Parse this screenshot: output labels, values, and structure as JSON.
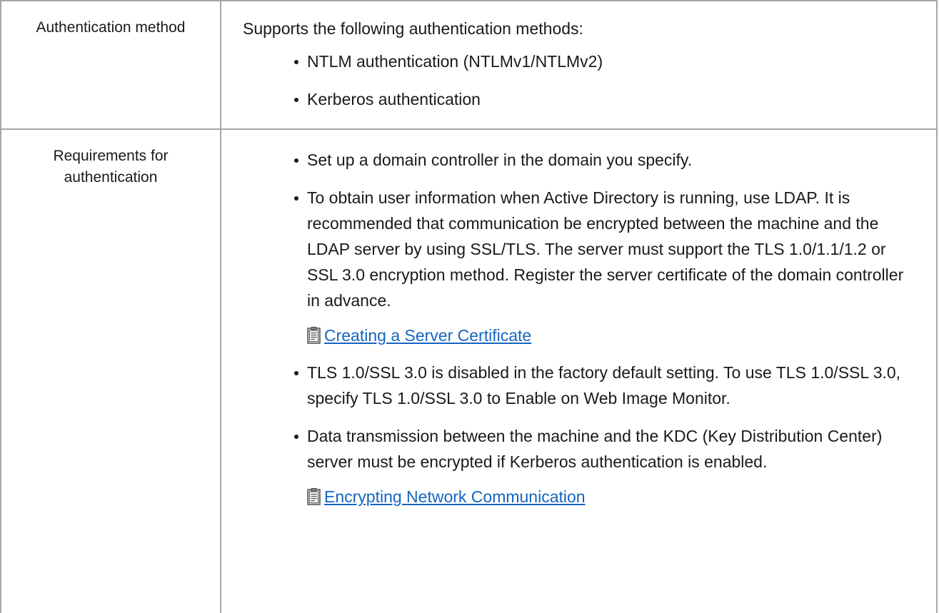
{
  "rows": [
    {
      "label": "Authentication method",
      "intro": "Supports the following authentication methods:",
      "items": [
        "NTLM authentication (NTLMv1/NTLMv2)",
        "Kerberos authentication"
      ]
    },
    {
      "label": "Requirements for authentication",
      "items": [
        "Set up a domain controller in the domain you specify.",
        "To obtain user information when Active Directory is running, use LDAP. It is recommended that communication be encrypted between the machine and the LDAP server by using SSL/TLS. The server must support the TLS 1.0/1.1/1.2 or SSL 3.0 encryption method. Register the server certificate of the domain controller in advance.",
        "TLS 1.0/SSL 3.0 is disabled in the factory default setting. To use TLS 1.0/SSL 3.0, specify TLS 1.0/SSL 3.0 to Enable on Web Image Monitor.",
        "Data transmission between the machine and the KDC (Key Distribution Center) server must be encrypted if Kerberos authentication is enabled."
      ],
      "links": [
        "Creating a Server Certificate",
        "Encrypting Network Communication"
      ]
    }
  ],
  "icons": {
    "reference": "clipboard-icon"
  },
  "colors": {
    "link": "#1565c0",
    "border": "#a6a6a6",
    "text": "#1a1a1a"
  }
}
